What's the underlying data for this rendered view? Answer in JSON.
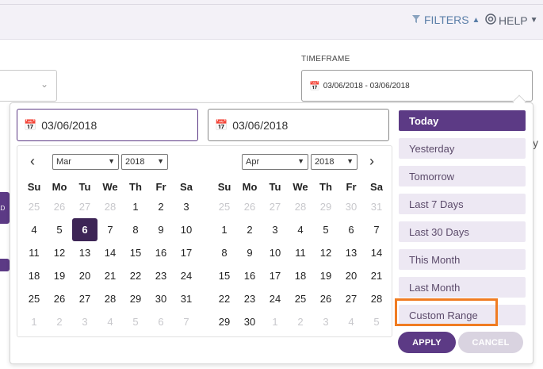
{
  "header": {
    "filters_label": "FILTERS",
    "help_label": "HELP",
    "filter_icon": "filter-funnel-icon",
    "help_icon": "lifebuoy-icon"
  },
  "timeframe": {
    "label": "TIMEFRAME",
    "value": "03/06/2018 - 03/06/2018"
  },
  "side": {
    "button1_fragment": "LD",
    "right_fragment": "y"
  },
  "picker": {
    "start_input": "03/06/2018",
    "end_input": "03/06/2018",
    "weekdays": [
      "Su",
      "Mo",
      "Tu",
      "We",
      "Th",
      "Fr",
      "Sa"
    ],
    "left": {
      "month": "Mar",
      "year": "2018",
      "weeks": [
        [
          {
            "d": "25",
            "off": true
          },
          {
            "d": "26",
            "off": true
          },
          {
            "d": "27",
            "off": true
          },
          {
            "d": "28",
            "off": true
          },
          {
            "d": "1"
          },
          {
            "d": "2"
          },
          {
            "d": "3"
          }
        ],
        [
          {
            "d": "4"
          },
          {
            "d": "5"
          },
          {
            "d": "6",
            "active": true
          },
          {
            "d": "7"
          },
          {
            "d": "8"
          },
          {
            "d": "9"
          },
          {
            "d": "10"
          }
        ],
        [
          {
            "d": "11"
          },
          {
            "d": "12"
          },
          {
            "d": "13"
          },
          {
            "d": "14"
          },
          {
            "d": "15"
          },
          {
            "d": "16"
          },
          {
            "d": "17"
          }
        ],
        [
          {
            "d": "18"
          },
          {
            "d": "19"
          },
          {
            "d": "20"
          },
          {
            "d": "21"
          },
          {
            "d": "22"
          },
          {
            "d": "23"
          },
          {
            "d": "24"
          }
        ],
        [
          {
            "d": "25"
          },
          {
            "d": "26"
          },
          {
            "d": "27"
          },
          {
            "d": "28"
          },
          {
            "d": "29"
          },
          {
            "d": "30"
          },
          {
            "d": "31"
          }
        ],
        [
          {
            "d": "1",
            "off": true
          },
          {
            "d": "2",
            "off": true
          },
          {
            "d": "3",
            "off": true
          },
          {
            "d": "4",
            "off": true
          },
          {
            "d": "5",
            "off": true
          },
          {
            "d": "6",
            "off": true
          },
          {
            "d": "7",
            "off": true
          }
        ]
      ]
    },
    "right": {
      "month": "Apr",
      "year": "2018",
      "weeks": [
        [
          {
            "d": "25",
            "off": true
          },
          {
            "d": "26",
            "off": true
          },
          {
            "d": "27",
            "off": true
          },
          {
            "d": "28",
            "off": true
          },
          {
            "d": "29",
            "off": true
          },
          {
            "d": "30",
            "off": true
          },
          {
            "d": "31",
            "off": true
          }
        ],
        [
          {
            "d": "1"
          },
          {
            "d": "2"
          },
          {
            "d": "3"
          },
          {
            "d": "4"
          },
          {
            "d": "5"
          },
          {
            "d": "6"
          },
          {
            "d": "7"
          }
        ],
        [
          {
            "d": "8"
          },
          {
            "d": "9"
          },
          {
            "d": "10"
          },
          {
            "d": "11"
          },
          {
            "d": "12"
          },
          {
            "d": "13"
          },
          {
            "d": "14"
          }
        ],
        [
          {
            "d": "15"
          },
          {
            "d": "16"
          },
          {
            "d": "17"
          },
          {
            "d": "18"
          },
          {
            "d": "19"
          },
          {
            "d": "20"
          },
          {
            "d": "21"
          }
        ],
        [
          {
            "d": "22"
          },
          {
            "d": "23"
          },
          {
            "d": "24"
          },
          {
            "d": "25"
          },
          {
            "d": "26"
          },
          {
            "d": "27"
          },
          {
            "d": "28"
          }
        ],
        [
          {
            "d": "29"
          },
          {
            "d": "30"
          },
          {
            "d": "1",
            "off": true
          },
          {
            "d": "2",
            "off": true
          },
          {
            "d": "3",
            "off": true
          },
          {
            "d": "4",
            "off": true
          },
          {
            "d": "5",
            "off": true
          }
        ]
      ]
    },
    "ranges": [
      {
        "label": "Today",
        "active": true
      },
      {
        "label": "Yesterday"
      },
      {
        "label": "Tomorrow"
      },
      {
        "label": "Last 7 Days"
      },
      {
        "label": "Last 30 Days"
      },
      {
        "label": "This Month"
      },
      {
        "label": "Last Month"
      },
      {
        "label": "Custom Range",
        "highlighted": true
      }
    ],
    "apply_label": "APPLY",
    "cancel_label": "CANCEL"
  },
  "colors": {
    "brand_purple": "#5c3a85",
    "active_day": "#3d2556",
    "range_bg": "#ede8f3",
    "highlight_outline": "#f07c22",
    "filters_link": "#5b7fa8"
  }
}
